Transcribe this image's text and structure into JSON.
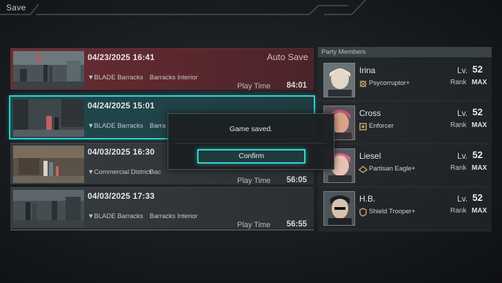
{
  "header": {
    "title": "Save"
  },
  "slots": [
    {
      "date": "04/23/2025 16:41",
      "location": "▼BLADE Barracks",
      "sublocation": "Barracks Interior",
      "badge": "Auto Save",
      "playtime_label": "Play Time",
      "playtime": "84:01"
    },
    {
      "date": "04/24/2025 15:01",
      "location": "▼BLADE Barracks",
      "sublocation": "Barra"
    },
    {
      "date": "04/03/2025 16:30",
      "location": "▼Commercial District",
      "sublocation": "Bac",
      "playtime_label": "Play Time",
      "playtime": "56:05"
    },
    {
      "date": "04/03/2025 17:33",
      "location": "▼BLADE Barracks",
      "sublocation": "Barracks Interior",
      "playtime_label": "Play Time",
      "playtime": "56:55"
    }
  ],
  "party": {
    "header": "Party Members",
    "lv_label": "Lv.",
    "rank_label": "Rank",
    "members": [
      {
        "name": "Irina",
        "class": "Psycorruptor+",
        "level": "52",
        "rank": "MAX",
        "icon": "psycorruptor-icon"
      },
      {
        "name": "Cross",
        "class": "Enforcer",
        "level": "52",
        "rank": "MAX",
        "icon": "enforcer-icon"
      },
      {
        "name": "Liesel",
        "class": "Partisan Eagle+",
        "level": "52",
        "rank": "MAX",
        "icon": "partisan-eagle-icon"
      },
      {
        "name": "H.B.",
        "class": "Shield Trooper+",
        "level": "52",
        "rank": "MAX",
        "icon": "shield-trooper-icon"
      }
    ]
  },
  "dialog": {
    "message": "Game saved.",
    "confirm_label": "Confirm"
  },
  "colors": {
    "accent": "#2fd3cf",
    "autosave": "#6a2d34"
  }
}
